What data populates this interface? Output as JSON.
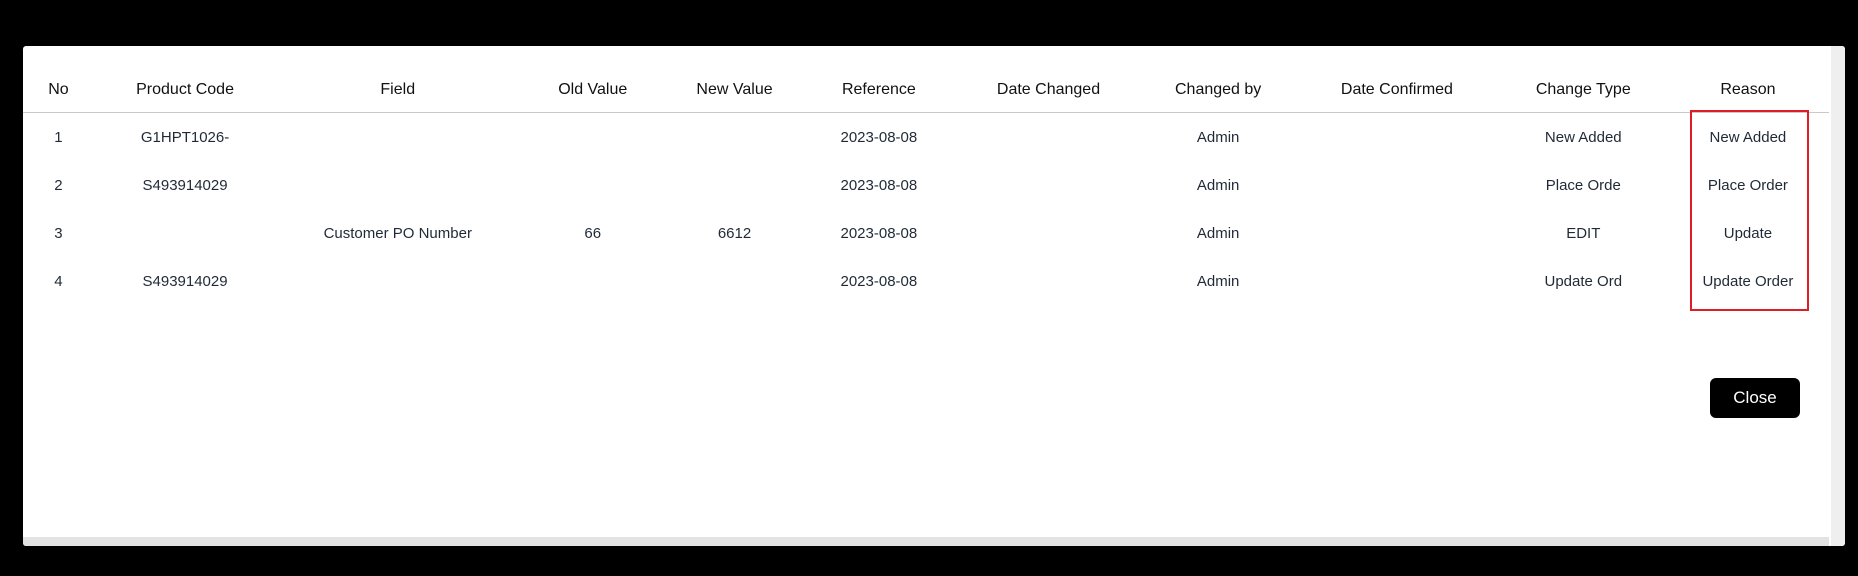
{
  "table": {
    "headers": [
      "No",
      "Product Code",
      "Field",
      "Old Value",
      "New Value",
      "Reference",
      "Date Changed",
      "Changed by",
      "Date Confirmed",
      "Change Type",
      "Reason"
    ],
    "rows": [
      [
        "1",
        "G1HPT1026-",
        "",
        "",
        "",
        "2023-08-08",
        "",
        "Admin",
        "",
        "New Added",
        "New Added"
      ],
      [
        "2",
        "S493914029",
        "",
        "",
        "",
        "2023-08-08",
        "",
        "Admin",
        "",
        "Place Orde",
        "Place Order"
      ],
      [
        "3",
        "",
        "Customer PO Number",
        "66",
        "6612",
        "2023-08-08",
        "",
        "Admin",
        "",
        "EDIT",
        "Update"
      ],
      [
        "4",
        "S493914029",
        "",
        "",
        "",
        "2023-08-08",
        "",
        "Admin",
        "",
        "Update Ord",
        "Update Order"
      ]
    ]
  },
  "close_label": "Close",
  "highlight_color": "#e01c24"
}
